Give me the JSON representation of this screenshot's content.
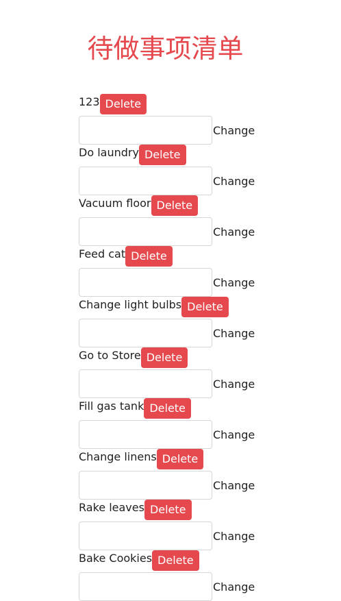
{
  "page": {
    "title": "待做事项清单"
  },
  "todo": {
    "items": [
      {
        "text": "123",
        "delete_label": "Delete",
        "change_label": "Change",
        "input_value": ""
      },
      {
        "text": "Do laundry",
        "delete_label": "Delete",
        "change_label": "Change",
        "input_value": ""
      },
      {
        "text": "Vacuum floor",
        "delete_label": "Delete",
        "change_label": "Change",
        "input_value": ""
      },
      {
        "text": "Feed cat",
        "delete_label": "Delete",
        "change_label": "Change",
        "input_value": ""
      },
      {
        "text": "Change light bulbs",
        "delete_label": "Delete",
        "change_label": "Change",
        "input_value": ""
      },
      {
        "text": "Go to Store",
        "delete_label": "Delete",
        "change_label": "Change",
        "input_value": ""
      },
      {
        "text": "Fill gas tank",
        "delete_label": "Delete",
        "change_label": "Change",
        "input_value": ""
      },
      {
        "text": "Change linens",
        "delete_label": "Delete",
        "change_label": "Change",
        "input_value": ""
      },
      {
        "text": "Rake leaves",
        "delete_label": "Delete",
        "change_label": "Change",
        "input_value": ""
      },
      {
        "text": "Bake Cookies",
        "delete_label": "Delete",
        "change_label": "Change",
        "input_value": ""
      }
    ]
  },
  "colors": {
    "accent": "#e5484d",
    "text": "#1f1f1f",
    "input_border": "#d6d6d6",
    "background": "#ffffff"
  }
}
